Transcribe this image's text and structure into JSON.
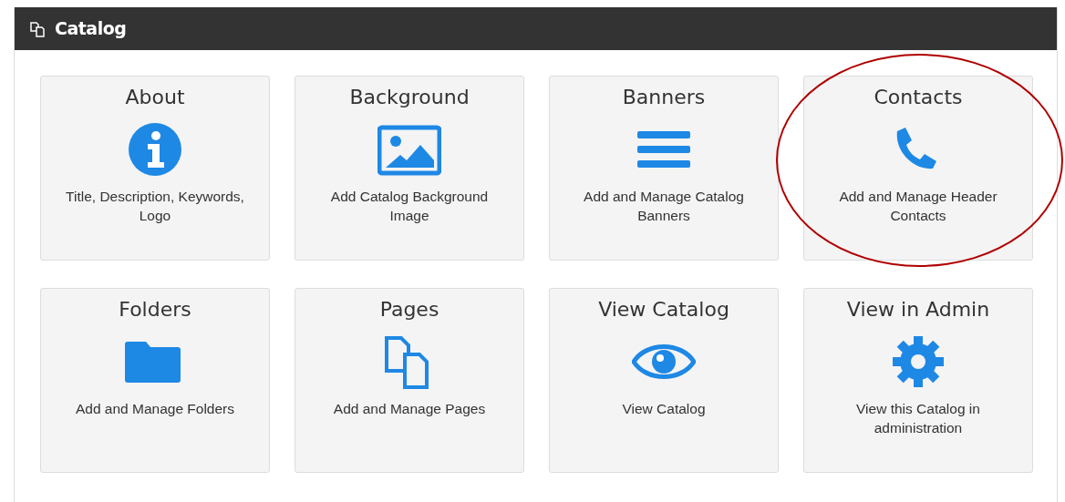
{
  "panel": {
    "title": "Catalog"
  },
  "tiles": [
    {
      "title": "About",
      "kind": "info",
      "description": "Title, Description, Keywords, Logo",
      "circled": false
    },
    {
      "title": "Background",
      "kind": "image",
      "description": "Add Catalog Background Image",
      "circled": false
    },
    {
      "title": "Banners",
      "kind": "bars",
      "description": "Add and Manage Catalog Banners",
      "circled": false
    },
    {
      "title": "Contacts",
      "kind": "phone",
      "description": "Add and Manage Header Contacts",
      "circled": true
    },
    {
      "title": "Folders",
      "kind": "folder",
      "description": "Add and Manage Folders",
      "circled": false
    },
    {
      "title": "Pages",
      "kind": "pages",
      "description": "Add and Manage Pages",
      "circled": false
    },
    {
      "title": "View Catalog",
      "kind": "eye",
      "description": "View Catalog",
      "circled": false
    },
    {
      "title": "View in Admin",
      "kind": "gear",
      "description": "View this Catalog in administration",
      "circled": false
    }
  ]
}
